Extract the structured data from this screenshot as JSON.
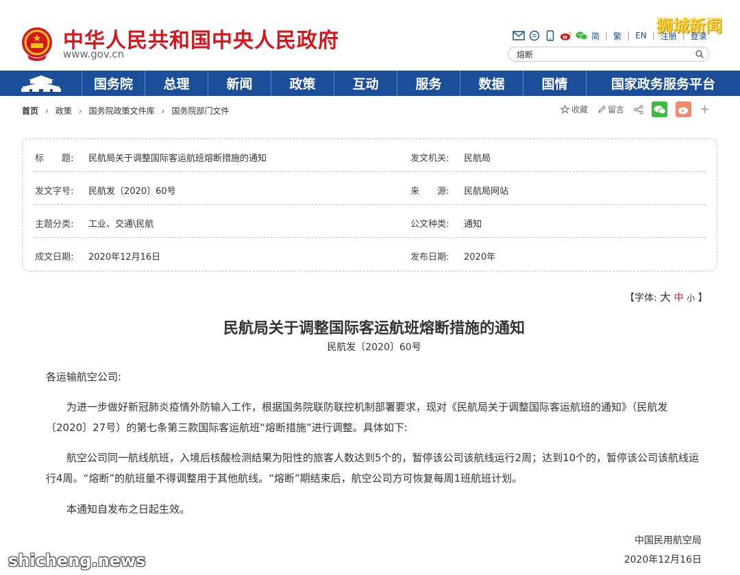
{
  "header": {
    "site_title": "中华人民共和国中央人民政府",
    "site_url": "www.gov.cn",
    "watermark": "狮城新闻",
    "langs": [
      "简",
      "繁",
      "EN"
    ],
    "register": "注册",
    "login": "登录",
    "search_value": "熔断"
  },
  "nav": {
    "items": [
      "国务院",
      "总理",
      "新闻",
      "政策",
      "互动",
      "服务",
      "数据",
      "国情",
      "国家政务服务平台"
    ]
  },
  "breadcrumb": [
    "首页",
    "政策",
    "国务院政策文件库",
    "国务院部门文件"
  ],
  "share": {
    "favorite": "收藏",
    "comment": "留言",
    "plus": "+"
  },
  "meta": {
    "title_label": "标　　题:",
    "title_value": "民航局关于调整国际客运航班熔断措施的通知",
    "issuer_label": "发文机关:",
    "issuer_value": "民航局",
    "docno_label": "发文字号:",
    "docno_value": "民航发〔2020〕60号",
    "source_label": "来　　源:",
    "source_value": "民航局网站",
    "topic_label": "主题分类:",
    "topic_value": "工业、交通\\民航",
    "type_label": "公文种类:",
    "type_value": "通知",
    "written_label": "成文日期:",
    "written_value": "2020年12月16日",
    "published_label": "发布日期:",
    "published_value": "2020年"
  },
  "font_size": {
    "prefix": "【字体:",
    "big": "大",
    "mid": "中",
    "small": "小",
    "suffix": "】"
  },
  "article": {
    "title": "民航局关于调整国际客运航班熔断措施的通知",
    "doc_no": "民航发〔2020〕60号",
    "salutation": "各运输航空公司:",
    "p1": "为进一步做好新冠肺炎疫情外防输入工作，根据国务院联防联控机制部署要求，现对《民航局关于调整国际客运航班的通知》（民航发〔2020〕27号）的第七条第三款国际客运航班“熔断措施”进行调整。具体如下:",
    "p2": "航空公司同一航线航班，入境后核酸检测结果为阳性的旅客人数达到5个的，暂停该公司该航线运行2周；达到10个的，暂停该公司该航线运行4周。“熔断”的航班量不得调整用于其他航线。“熔断”期结束后，航空公司方可恢复每周1班航班计划。",
    "p3": "本通知自发布之日起生效。",
    "signer": "中国民用航空局",
    "date": "2020年12月16日"
  },
  "watermark_bottom": "shicheng.news",
  "colors": {
    "brand_red": "#d4161e",
    "nav_blue": "#1b4e98",
    "link_blue": "#1b4f9c",
    "wechat_green": "#3dbb3d",
    "weibo_orange": "#f08a6c"
  }
}
